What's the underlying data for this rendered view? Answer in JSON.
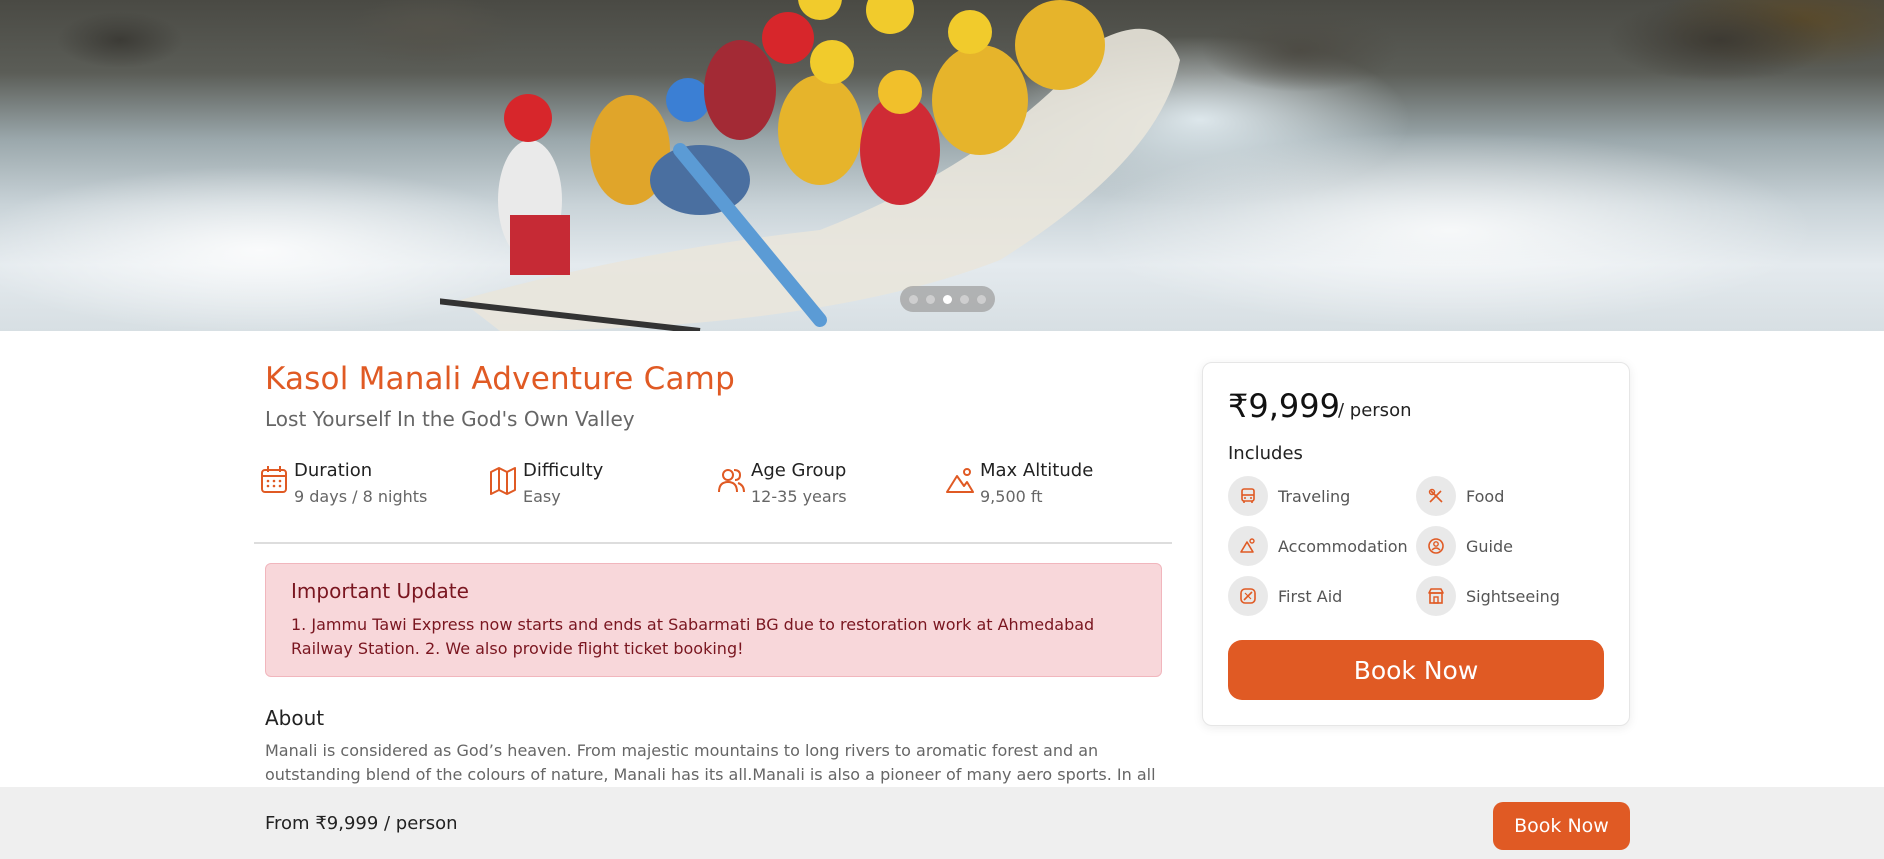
{
  "hero": {
    "image_description_icon": "rafting-photo",
    "carousel": {
      "count": 5,
      "active_index": 2
    }
  },
  "trip": {
    "title": "Kasol Manali Adventure Camp",
    "subtitle": "Lost Yourself In the God's Own Valley"
  },
  "stats": [
    {
      "icon": "calendar-icon",
      "label": "Duration",
      "value": "9 days / 8 nights"
    },
    {
      "icon": "map-icon",
      "label": "Difficulty",
      "value": "Easy"
    },
    {
      "icon": "users-icon",
      "label": "Age Group",
      "value": "12-35 years"
    },
    {
      "icon": "mountain-icon",
      "label": "Max Altitude",
      "value": "9,500 ft"
    }
  ],
  "alert": {
    "title": "Important Update",
    "text": "1. Jammu Tawi Express now starts and ends at Sabarmati BG due to restoration work at Ahmedabad Railway Station. 2. We also provide flight ticket booking!"
  },
  "about": {
    "heading": "About",
    "text": "Manali is considered as God’s heaven. From majestic mountains to long rivers to aromatic forest and an outstanding blend of the colours of nature, Manali has its all.Manali is also a pioneer of many aero sports. In all"
  },
  "card": {
    "price": "₹9,999",
    "per": "/ person",
    "includes_heading": "Includes",
    "includes": [
      {
        "icon": "bus-icon",
        "label": "Traveling"
      },
      {
        "icon": "food-icon",
        "label": "Food"
      },
      {
        "icon": "tent-icon",
        "label": "Accommodation"
      },
      {
        "icon": "guide-icon",
        "label": "Guide"
      },
      {
        "icon": "first-aid-icon",
        "label": "First Aid"
      },
      {
        "icon": "sightseeing-icon",
        "label": "Sightseeing"
      }
    ],
    "book_label": "Book Now"
  },
  "footer": {
    "price_text": "From ₹9,999 / person",
    "book_label": "Book Now"
  },
  "colors": {
    "accent": "#e05a24",
    "alert_bg": "#f8d7da",
    "alert_text": "#7a1620"
  }
}
